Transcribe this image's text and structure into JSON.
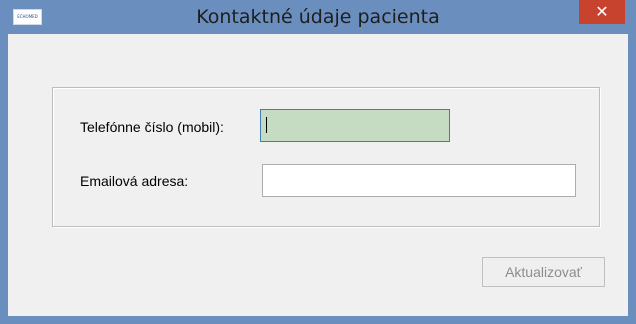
{
  "window": {
    "title": "Kontaktné údaje pacienta",
    "app_icon_text": "ECHOMED",
    "close_glyph": "✕"
  },
  "form": {
    "phone_label": "Telefónne číslo (mobil):",
    "phone_value": "",
    "email_label": "Emailová adresa:",
    "email_value": ""
  },
  "actions": {
    "update_label": "Aktualizovať"
  },
  "colors": {
    "titlebar": "#6a8fbe",
    "close_button": "#c7432e",
    "focused_input": "#c5dcc2"
  }
}
